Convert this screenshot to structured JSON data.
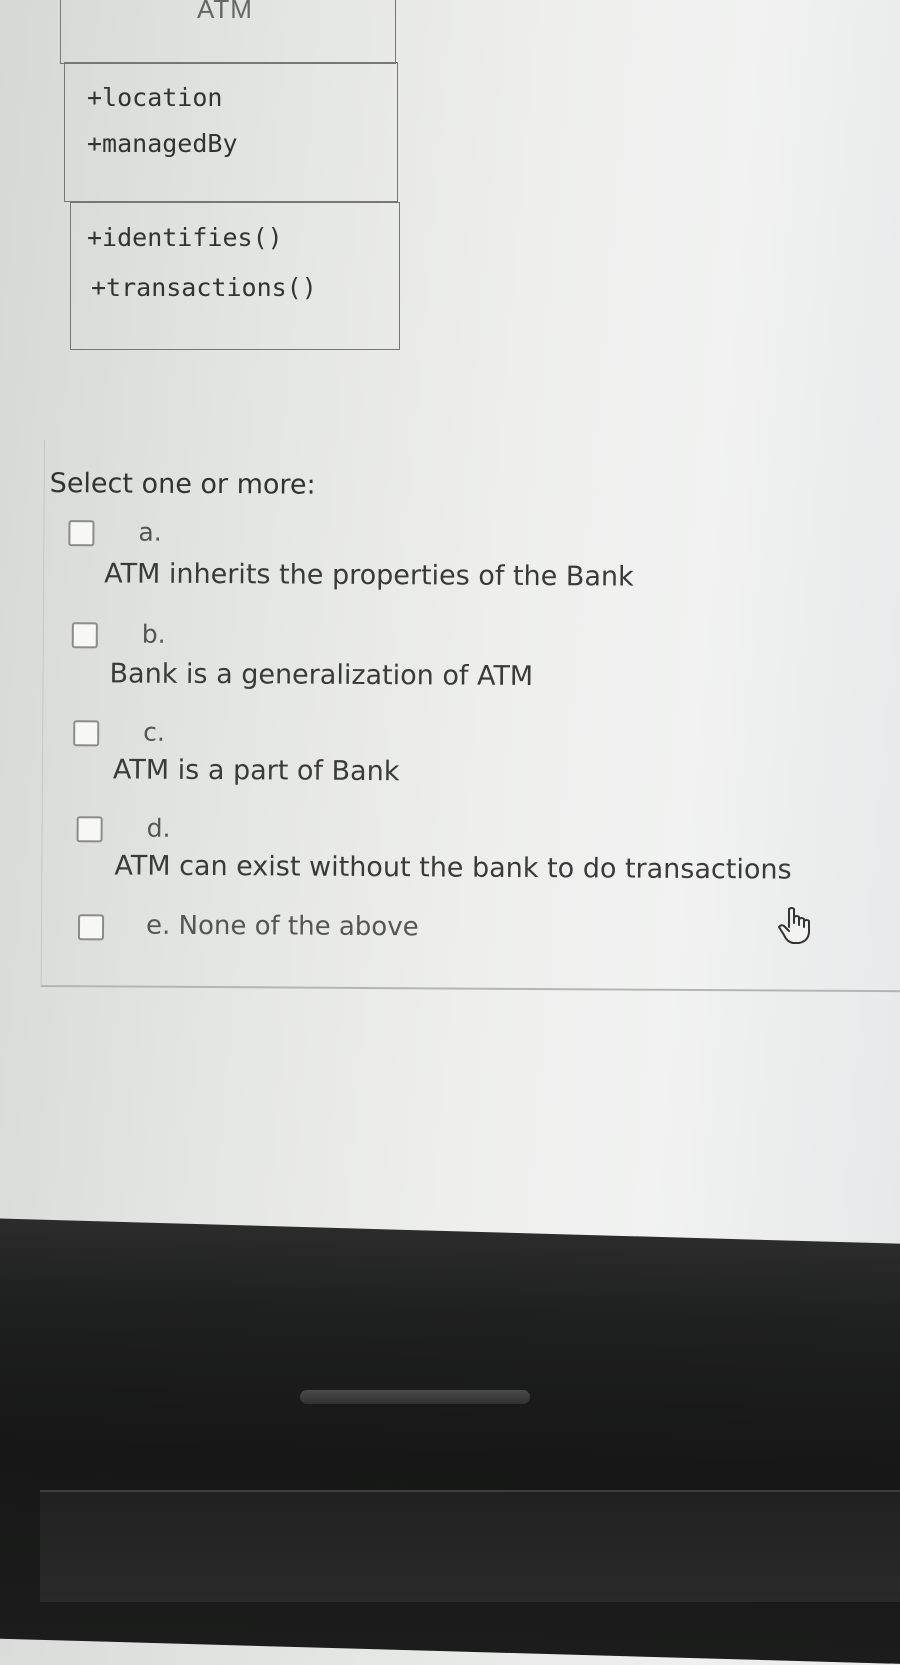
{
  "uml": {
    "class_name": "ATM",
    "attributes": [
      "+location",
      "+managedBy"
    ],
    "methods": [
      "+identifies()",
      "+transactions()"
    ]
  },
  "quiz": {
    "prompt": "Select one or more:",
    "options": [
      {
        "letter": "a.",
        "text": "ATM inherits the properties of the Bank"
      },
      {
        "letter": "b.",
        "text": "Bank is a generalization of ATM"
      },
      {
        "letter": "c.",
        "text": "ATM is a part of Bank"
      },
      {
        "letter": "d.",
        "text": "ATM can exist without the bank to do transactions"
      },
      {
        "letter": "",
        "text": "e. None of the above"
      }
    ]
  },
  "icons": {
    "cursor": "hand-pointer-icon"
  }
}
